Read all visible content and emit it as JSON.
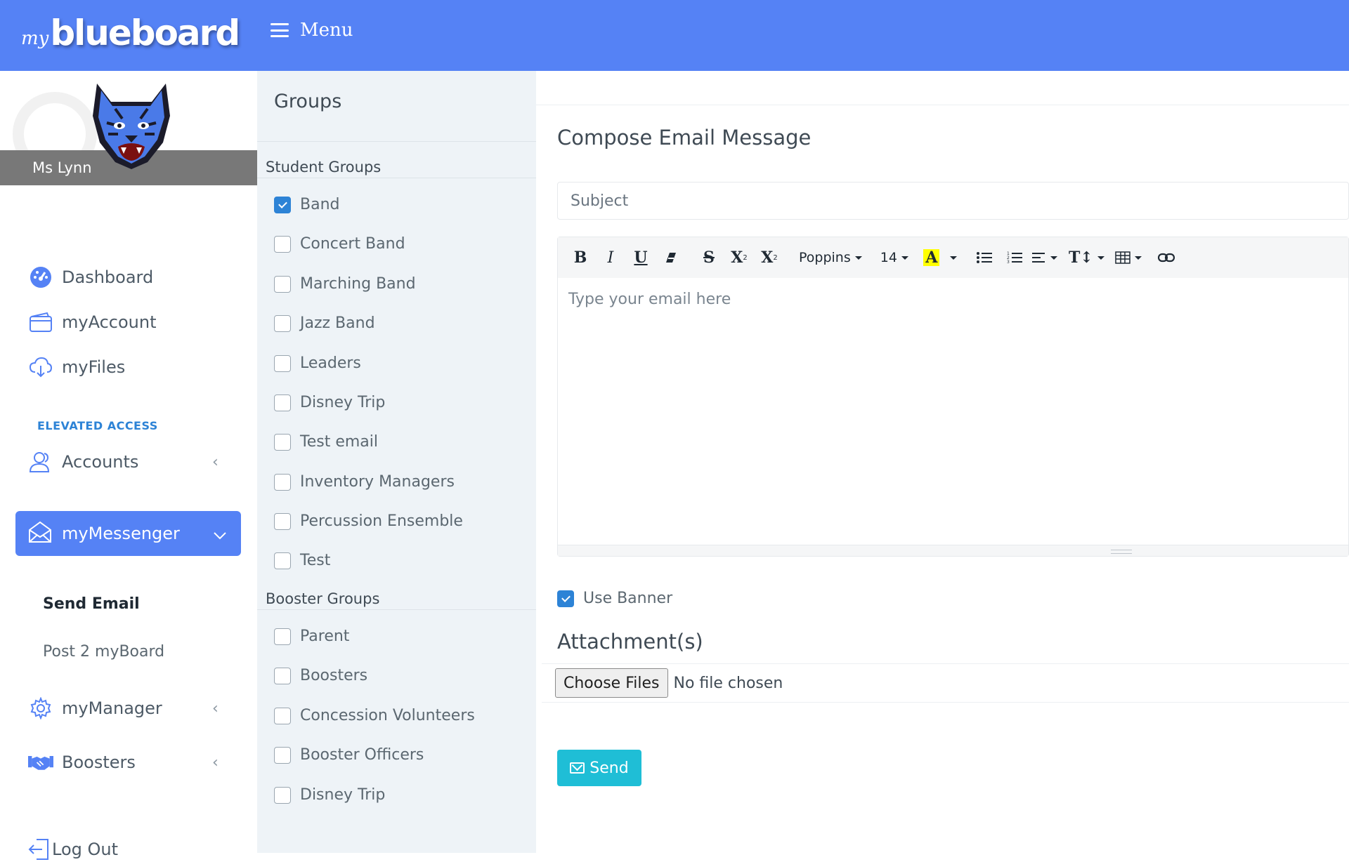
{
  "header": {
    "logo_prefix": "my",
    "logo_brand": "blueboard",
    "menu_label": "Menu"
  },
  "profile": {
    "name": "Ms Lynn",
    "avatar_icon": "tiger-mascot-icon"
  },
  "sidebar": {
    "items": [
      {
        "label": "Dashboard",
        "icon": "dashboard-icon"
      },
      {
        "label": "myAccount",
        "icon": "wallet-icon"
      },
      {
        "label": "myFiles",
        "icon": "cloud-download-icon"
      }
    ],
    "section_label": "ELEVATED ACCESS",
    "elevated": [
      {
        "label": "Accounts",
        "icon": "users-icon"
      },
      {
        "label": "myMessenger",
        "icon": "envelope-open-icon"
      },
      {
        "label": "myManager",
        "icon": "gear-icon"
      },
      {
        "label": "Boosters",
        "icon": "handshake-icon"
      }
    ],
    "messenger_sub": [
      {
        "label": "Send Email"
      },
      {
        "label": "Post 2 myBoard"
      }
    ],
    "logout_label": "Log Out",
    "accent": "#5582f5"
  },
  "groups": {
    "title": "Groups",
    "student_heading": "Student Groups",
    "student": [
      {
        "label": "Band",
        "checked": true
      },
      {
        "label": "Concert Band",
        "checked": false
      },
      {
        "label": "Marching Band",
        "checked": false
      },
      {
        "label": "Jazz Band",
        "checked": false
      },
      {
        "label": "Leaders",
        "checked": false
      },
      {
        "label": "Disney Trip",
        "checked": false
      },
      {
        "label": "Test email",
        "checked": false
      },
      {
        "label": "Inventory Managers",
        "checked": false
      },
      {
        "label": "Percussion Ensemble",
        "checked": false
      },
      {
        "label": "Test",
        "checked": false
      }
    ],
    "booster_heading": "Booster Groups",
    "booster": [
      {
        "label": "Parent",
        "checked": false
      },
      {
        "label": "Boosters",
        "checked": false
      },
      {
        "label": "Concession Volunteers",
        "checked": false
      },
      {
        "label": "Booster Officers",
        "checked": false
      },
      {
        "label": "Disney Trip",
        "checked": false
      }
    ]
  },
  "compose": {
    "title": "Compose Email Message",
    "subject_placeholder": "Subject",
    "toolbar": {
      "bold": "B",
      "italic": "I",
      "underline": "U",
      "strike": "S",
      "superscript": "X",
      "subscript": "X",
      "font": "Poppins",
      "size": "14",
      "highlight": "A",
      "font_size_icon": "T↕"
    },
    "body_placeholder": "Type your email here",
    "use_banner_label": "Use Banner",
    "use_banner_checked": true,
    "attachments_title": "Attachment(s)",
    "choose_files_label": "Choose Files",
    "no_file_label": "No file chosen",
    "send_label": "Send",
    "send_color": "#1fbed6"
  }
}
